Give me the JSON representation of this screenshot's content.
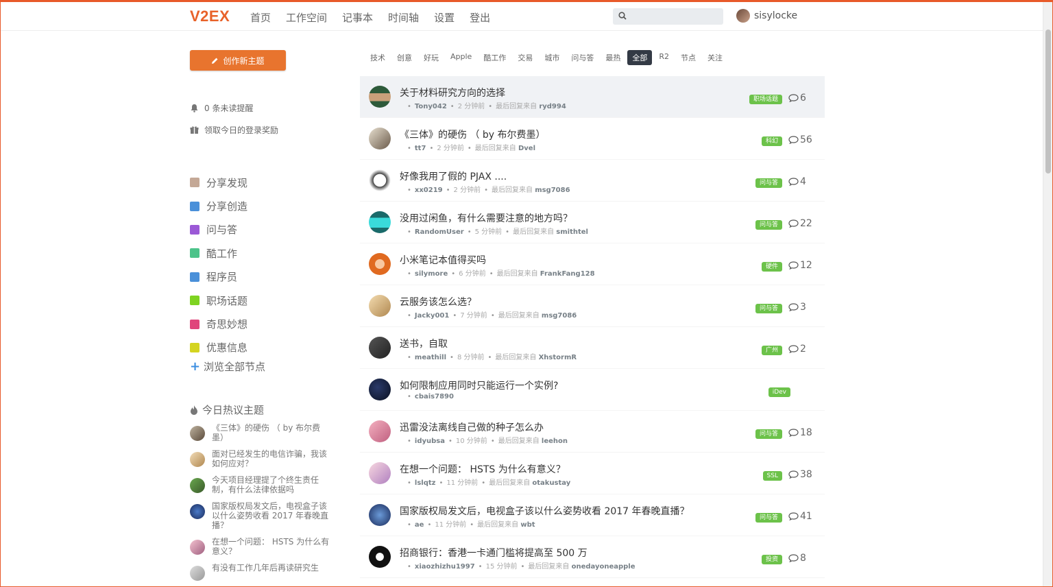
{
  "header": {
    "logo": "V2EX",
    "nav": [
      "首页",
      "工作空间",
      "记事本",
      "时间轴",
      "设置",
      "登出"
    ],
    "search_placeholder": "",
    "username": "sisylocke"
  },
  "sidebar": {
    "new_topic_label": "创作新主题",
    "unread": "0 条未读提醒",
    "daily_reward": "领取今日的登录奖励",
    "nodes": [
      {
        "label": "分享发现",
        "color": "#c4a896"
      },
      {
        "label": "分享创造",
        "color": "#4a90d9"
      },
      {
        "label": "问与答",
        "color": "#9b59d6"
      },
      {
        "label": "酷工作",
        "color": "#4cc38a"
      },
      {
        "label": "程序员",
        "color": "#4a90d9"
      },
      {
        "label": "职场话题",
        "color": "#7ed321"
      },
      {
        "label": "奇思妙想",
        "color": "#e0457b"
      },
      {
        "label": "优惠信息",
        "color": "#d4d420"
      }
    ],
    "browse_all": "浏览全部节点",
    "hot_title": "今日热议主题",
    "hot_topics": [
      "《三体》的硬伤 （ by 布尔费墨）",
      "面对已经发生的电信诈骗，我该如何应对？",
      "今天项目经理提了个终生责任制，有什么法律依据吗",
      "国家版权局发文后，电视盒子该以什么姿势收看 2017 年春晚直播？",
      "在想一个问题： HSTS 为什么有意义？",
      "有没有工作几年后再读研究生"
    ]
  },
  "tabs": [
    "技术",
    "创意",
    "好玩",
    "Apple",
    "酷工作",
    "交易",
    "城市",
    "问与答",
    "最热",
    "全部",
    "R2",
    "节点",
    "关注"
  ],
  "active_tab": "全部",
  "topics": [
    {
      "title": "关于材料研究方向的选择",
      "author": "Tony042",
      "time": "2 分钟前",
      "last": "ryd994",
      "node": "职场话题",
      "count": "6"
    },
    {
      "title": "《三体》的硬伤 （ by 布尔费墨）",
      "author": "tt7",
      "time": "2 分钟前",
      "last": "Dvel",
      "node": "科幻",
      "count": "56"
    },
    {
      "title": "好像我用了假的 PJAX ....",
      "author": "xx0219",
      "time": "2 分钟前",
      "last": "msg7086",
      "node": "问与答",
      "count": "4"
    },
    {
      "title": "没用过闲鱼，有什么需要注意的地方吗？",
      "author": "RandomUser",
      "time": "5 分钟前",
      "last": "smithtel",
      "node": "问与答",
      "count": "22"
    },
    {
      "title": "小米笔记本值得买吗",
      "author": "silymore",
      "time": "6 分钟前",
      "last": "FrankFang128",
      "node": "硬件",
      "count": "12"
    },
    {
      "title": "云服务该怎么选？",
      "author": "Jacky001",
      "time": "7 分钟前",
      "last": "msg7086",
      "node": "问与答",
      "count": "3"
    },
    {
      "title": "送书，自取",
      "author": "meathill",
      "time": "8 分钟前",
      "last": "XhstormR",
      "node": "广州",
      "count": "2"
    },
    {
      "title": "如何限制应用同时只能运行一个实例?",
      "author": "cbais7890",
      "time": "",
      "last": "",
      "node": "iDev",
      "count": ""
    },
    {
      "title": "迅雷没法离线自己做的种子怎么办",
      "author": "idyubsa",
      "time": "10 分钟前",
      "last": "leehon",
      "node": "问与答",
      "count": "18"
    },
    {
      "title": "在想一个问题： HSTS 为什么有意义？",
      "author": "lslqtz",
      "time": "11 分钟前",
      "last": "otakustay",
      "node": "SSL",
      "count": "38"
    },
    {
      "title": "国家版权局发文后，电视盒子该以什么姿势收看 2017 年春晚直播？",
      "author": "ae",
      "time": "11 分钟前",
      "last": "wbt",
      "node": "问与答",
      "count": "41"
    },
    {
      "title": "招商银行：香港一卡通门槛将提高至 500 万",
      "author": "xiaozhizhu1997",
      "time": "15 分钟前",
      "last": "onedayoneapple",
      "node": "投资",
      "count": "8"
    }
  ],
  "meta_last_prefix": "最后回复来自"
}
